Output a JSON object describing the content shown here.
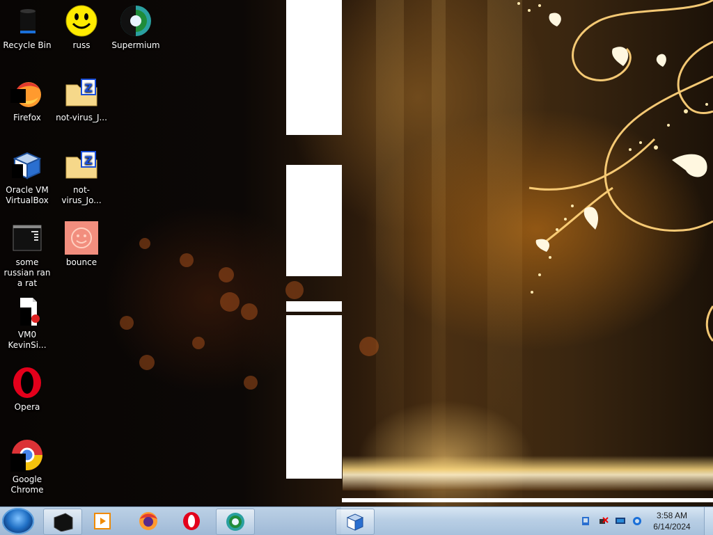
{
  "desktop_icons": [
    {
      "name": "recycle-bin",
      "label": "Recycle Bin"
    },
    {
      "name": "russ",
      "label": "russ"
    },
    {
      "name": "supermium",
      "label": "Supermium"
    },
    {
      "name": "firefox",
      "label": "Firefox"
    },
    {
      "name": "not-virus-1",
      "label": "not-virus_J..."
    },
    {
      "name": "oracle-vm-virtualbox",
      "label": "Oracle VM VirtualBox"
    },
    {
      "name": "not-virus-2",
      "label": "not-virus_Jo..."
    },
    {
      "name": "some-russian",
      "label": "some russian ran a rat"
    },
    {
      "name": "bounce",
      "label": "bounce"
    },
    {
      "name": "vm0",
      "label": "VM0 KevinSi..."
    },
    {
      "name": "opera",
      "label": "Opera"
    },
    {
      "name": "google-chrome",
      "label": "Google Chrome"
    }
  ],
  "taskbar": {
    "pinned": [
      "cmd-icon",
      "media-player-icon",
      "firefox-icon",
      "opera-icon",
      "supermium-icon"
    ],
    "running": [
      "virtualbox-icon"
    ]
  },
  "tray": {
    "icons": [
      "network-icon",
      "volume-muted-icon",
      "display-icon",
      "ie-icon"
    ],
    "time": "3:58 AM",
    "date": "6/14/2024"
  },
  "colors": {
    "taskbar": "#b9cfe5",
    "accent": "#1f6fc4"
  }
}
